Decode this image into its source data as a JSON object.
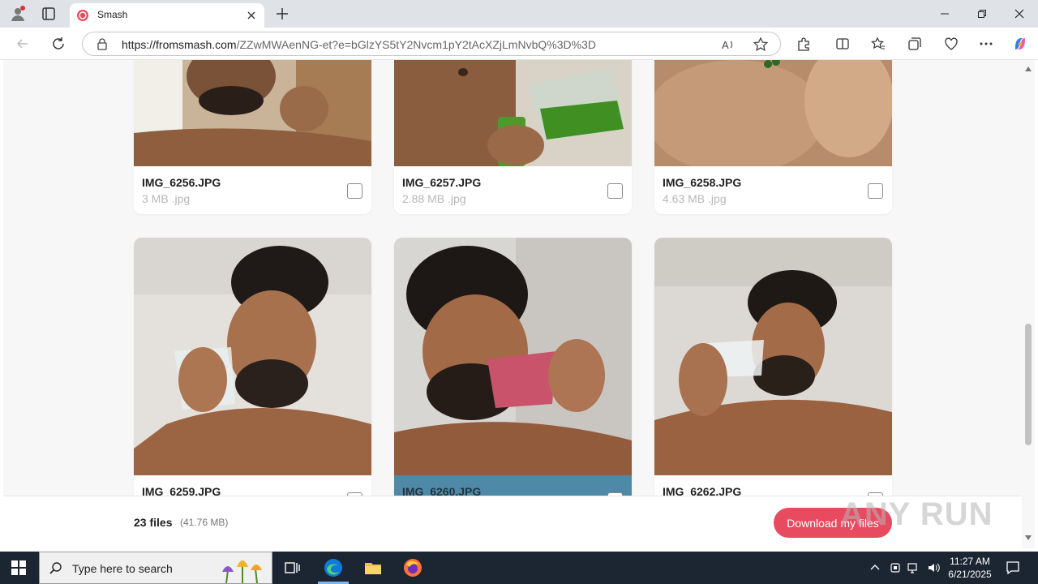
{
  "browser": {
    "tab_title": "Smash",
    "url_host": "https://fromsmash.com",
    "url_path": "/ZZwMWAenNG-et?e=bGlzYS5tY2Nvcm1pY2tAcXZjLmNvbQ%3D%3D"
  },
  "files": [
    {
      "name": "IMG_6256.JPG",
      "size": "3 MB .jpg",
      "selected": false
    },
    {
      "name": "IMG_6257.JPG",
      "size": "2.88 MB .jpg",
      "selected": false
    },
    {
      "name": "IMG_6258.JPG",
      "size": "4.63 MB .jpg",
      "selected": false
    },
    {
      "name": "IMG_6259.JPG",
      "size": "",
      "selected": false
    },
    {
      "name": "IMG_6260.JPG",
      "size": "",
      "selected": true
    },
    {
      "name": "IMG_6262.JPG",
      "size": "",
      "selected": false
    }
  ],
  "footer": {
    "file_count": "23 files",
    "total_size": "(41.76 MB)",
    "download_label": "Download my files"
  },
  "watermark": "ANY RUN",
  "taskbar": {
    "search_placeholder": "Type here to search",
    "time": "11:27 AM",
    "date": "6/21/2025"
  },
  "colors": {
    "accent": "#e84a5f",
    "selected": "#4e8aa8",
    "taskbar": "#1c2532"
  }
}
